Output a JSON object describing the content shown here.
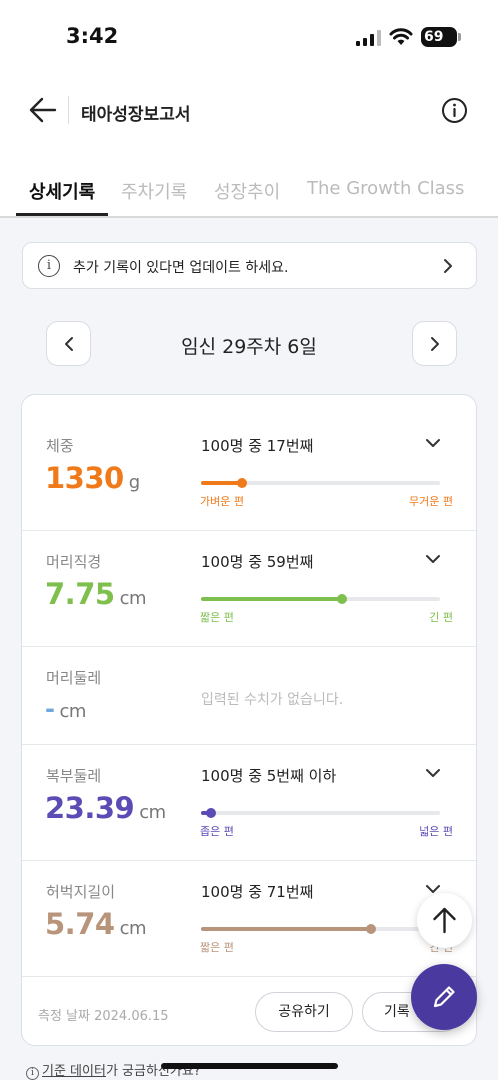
{
  "status_bar": {
    "time": "3:42",
    "battery": "69"
  },
  "app_bar": {
    "title": "태아성장보고서",
    "back_icon": "arrow-left-icon",
    "info_icon": "info-icon"
  },
  "tabs": [
    {
      "label": "상세기록",
      "active": true
    },
    {
      "label": "주차기록",
      "active": false
    },
    {
      "label": "성장추이",
      "active": false
    },
    {
      "label": "The Growth Class",
      "active": false
    }
  ],
  "notice": {
    "text": "추가 기록이 있다면 업데이트 하세요."
  },
  "week": {
    "title": "임신 29주차 6일"
  },
  "metrics": [
    {
      "label": "체중",
      "value": "1330",
      "unit": "g",
      "rank": "100명 중 17번째",
      "percentile": 0.17,
      "low_label": "가벼운 편",
      "high_label": "무거운 편",
      "color": "#f07a1a"
    },
    {
      "label": "머리직경",
      "value": "7.75",
      "unit": "cm",
      "rank": "100명 중 59번째",
      "percentile": 0.59,
      "low_label": "짧은 편",
      "high_label": "긴 편",
      "color": "#7fbf4d"
    },
    {
      "label": "머리둘레",
      "value": "-",
      "unit": "cm",
      "empty_text": "입력된 수치가 없습니다.",
      "color": "#6fa8dc"
    },
    {
      "label": "복부둘레",
      "value": "23.39",
      "unit": "cm",
      "rank": "100명 중 5번째 이하",
      "percentile": 0.04,
      "low_label": "좁은 편",
      "high_label": "넓은 편",
      "color": "#5a4bb5"
    },
    {
      "label": "허벅지길이",
      "value": "5.74",
      "unit": "cm",
      "rank": "100명 중 71번째",
      "percentile": 0.71,
      "low_label": "짧은 편",
      "high_label": "긴 편",
      "color": "#b8947a"
    }
  ],
  "footer": {
    "measure_date": "측정 날짜 2024.06.15",
    "share_label": "공유하기",
    "record_label": "기록 편집"
  },
  "help": {
    "prefix": "",
    "link": "기준 데이터",
    "suffix": "가 궁금하신가요?"
  }
}
